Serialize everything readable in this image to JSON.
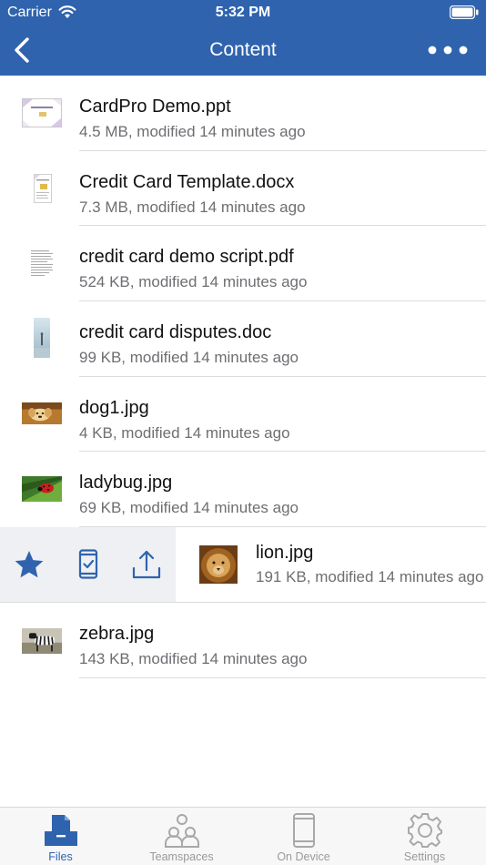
{
  "status_bar": {
    "carrier": "Carrier",
    "time": "5:32 PM"
  },
  "nav": {
    "title": "Content",
    "back_icon": "chevron-left-icon",
    "more_icon": "ellipsis-icon"
  },
  "files": [
    {
      "name": "CardPro Demo.ppt",
      "meta": "4.5 MB, modified 14 minutes ago",
      "thumb": "presentation"
    },
    {
      "name": "Credit Card Template.docx",
      "meta": "7.3 MB, modified 14 minutes ago",
      "thumb": "document"
    },
    {
      "name": "credit card demo script.pdf",
      "meta": "524 KB, modified 14 minutes ago",
      "thumb": "text-page"
    },
    {
      "name": "credit card disputes.doc",
      "meta": "99 KB, modified 14 minutes ago",
      "thumb": "photo-page"
    },
    {
      "name": "dog1.jpg",
      "meta": "4 KB, modified 14 minutes ago",
      "thumb": "dog-photo"
    },
    {
      "name": "ladybug.jpg",
      "meta": "69 KB, modified 14 minutes ago",
      "thumb": "ladybug-photo"
    },
    {
      "name": "lion.jpg",
      "meta": "191 KB, modified 14 minutes ago",
      "thumb": "lion-photo"
    },
    {
      "name": "zebra.jpg",
      "meta": "143 KB, modified 14 minutes ago",
      "thumb": "zebra-photo"
    }
  ],
  "swipe_actions": [
    "star-icon",
    "save-to-device-icon",
    "share-icon"
  ],
  "tabs": [
    {
      "label": "Files",
      "icon": "files-tray-icon",
      "active": true
    },
    {
      "label": "Teamspaces",
      "icon": "people-icon",
      "active": false
    },
    {
      "label": "On Device",
      "icon": "phone-icon",
      "active": false
    },
    {
      "label": "Settings",
      "icon": "gear-icon",
      "active": false
    }
  ],
  "colors": {
    "brand": "#2f63ae",
    "secondary_text": "#6e6e73",
    "inactive_tab": "#9a9a9a"
  }
}
